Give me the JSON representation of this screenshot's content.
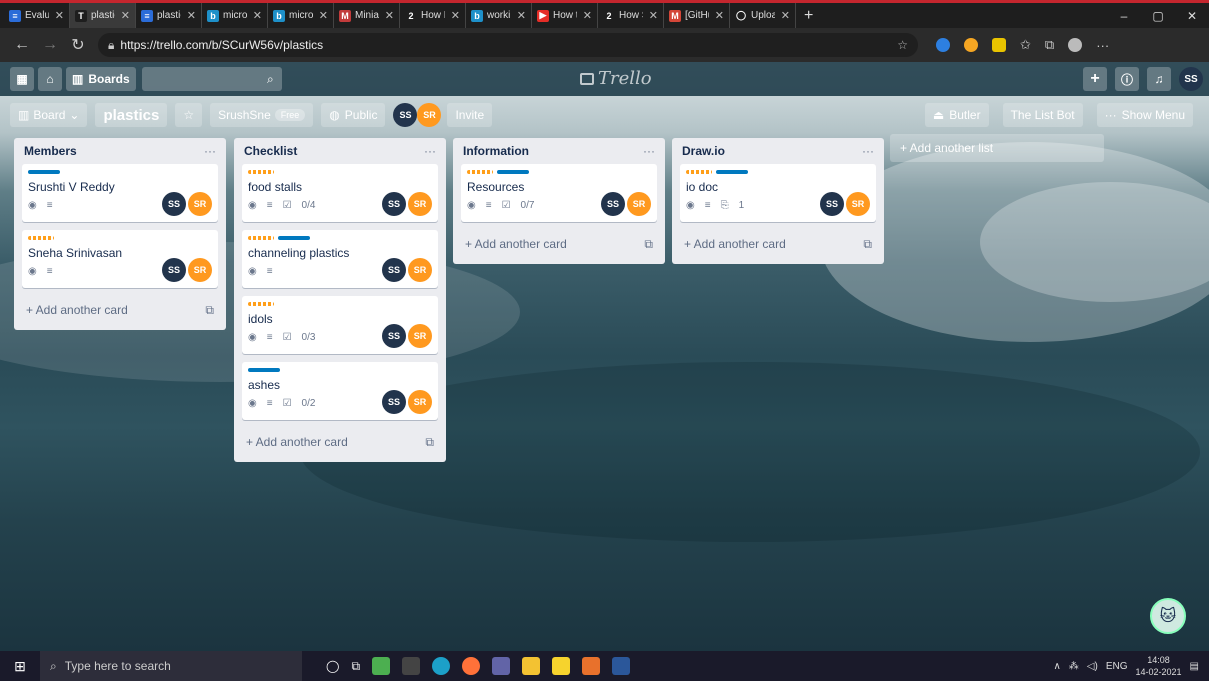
{
  "browser": {
    "tabs": [
      {
        "title": "Evaluati",
        "color": "#2b6cd8",
        "glyph": "≡"
      },
      {
        "title": "plastics",
        "color": "#1e1e1e",
        "glyph": "T",
        "active": true
      },
      {
        "title": "plastics",
        "color": "#2b6cd8",
        "glyph": "≡"
      },
      {
        "title": "micro m",
        "color": "#1e90c9",
        "glyph": "b"
      },
      {
        "title": "micro m",
        "color": "#1e90c9",
        "glyph": "b"
      },
      {
        "title": "Miniatu",
        "color": "#c23b3b",
        "glyph": "M"
      },
      {
        "title": "How Ma",
        "color": "#1e1e1e",
        "glyph": "2"
      },
      {
        "title": "working",
        "color": "#1e90c9",
        "glyph": "b"
      },
      {
        "title": "How to",
        "color": "#e52d27",
        "glyph": "▶"
      },
      {
        "title": "How Sw",
        "color": "#1e1e1e",
        "glyph": "2"
      },
      {
        "title": "[GitHub",
        "color": "#d44638",
        "glyph": "M"
      },
      {
        "title": "Upload",
        "color": "#1e1e1e",
        "glyph": "◯"
      }
    ],
    "new_tab": "+",
    "url": "https://trello.com/b/SCurW56v/plastics",
    "win_min": "–",
    "win_max": "▢",
    "win_close": "✕"
  },
  "header": {
    "boards_label": "Boards",
    "logo_text": "Trello",
    "user_initials": "SS"
  },
  "board": {
    "board_btn": "Board",
    "name": "plastics",
    "team": "SrushSne",
    "team_badge": "Free",
    "visibility": "Public",
    "invite": "Invite",
    "butler": "Butler",
    "list_bot": "The List Bot",
    "show_menu": "Show Menu",
    "add_list": "+ Add another list"
  },
  "avatars": {
    "ss": "SS",
    "sr": "SR"
  },
  "lists": [
    {
      "title": "Members",
      "add_card": "+ Add another card",
      "cards": [
        {
          "title": "Srushti V Reddy",
          "labels": [
            "blue"
          ],
          "check": ""
        },
        {
          "title": "Sneha Srinivasan",
          "labels": [
            "orange"
          ],
          "check": ""
        }
      ]
    },
    {
      "title": "Checklist",
      "add_card": "+ Add another card",
      "cards": [
        {
          "title": "food stalls",
          "labels": [
            "orange"
          ],
          "check": "0/4"
        },
        {
          "title": "channeling plastics",
          "labels": [
            "orange",
            "blue"
          ],
          "check": ""
        },
        {
          "title": "idols",
          "labels": [
            "orange"
          ],
          "check": "0/3"
        },
        {
          "title": "ashes",
          "labels": [
            "blue"
          ],
          "check": "0/2"
        }
      ]
    },
    {
      "title": "Information",
      "add_card": "+ Add another card",
      "cards": [
        {
          "title": "Resources",
          "labels": [
            "orange",
            "blue"
          ],
          "check": "0/7"
        }
      ]
    },
    {
      "title": "Draw.io",
      "add_card": "+ Add another card",
      "cards": [
        {
          "title": "io doc",
          "labels": [
            "orange",
            "blue"
          ],
          "check": "",
          "attach": "1"
        }
      ]
    }
  ],
  "taskbar": {
    "search_placeholder": "Type here to search",
    "lang": "ENG",
    "time": "14:08",
    "date": "14-02-2021"
  }
}
